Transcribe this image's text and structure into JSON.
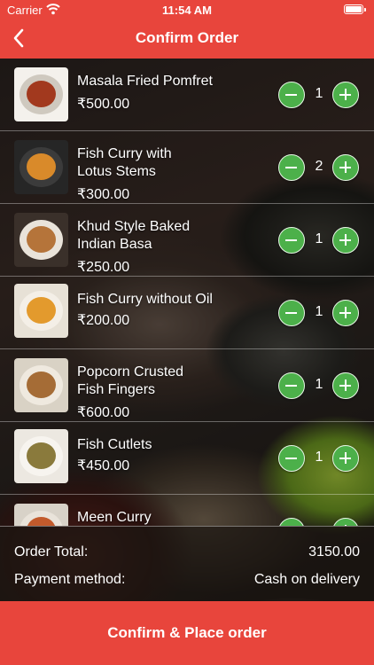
{
  "status_bar": {
    "carrier": "Carrier",
    "time": "11:54 AM"
  },
  "header": {
    "title": "Confirm Order",
    "back_icon": "chevron-left-icon"
  },
  "items": [
    {
      "name_line1": "Masala Fried Pomfret",
      "name_line2": "",
      "price": "₹500.00",
      "qty": "1"
    },
    {
      "name_line1": "Fish Curry with",
      "name_line2": "Lotus Stems",
      "price": "₹300.00",
      "qty": "2"
    },
    {
      "name_line1": "Khud Style Baked",
      "name_line2": "Indian Basa",
      "price": "₹250.00",
      "qty": "1"
    },
    {
      "name_line1": "Fish Curry without Oil",
      "name_line2": "",
      "price": "₹200.00",
      "qty": "1"
    },
    {
      "name_line1": "Popcorn Crusted",
      "name_line2": "Fish Fingers",
      "price": "₹600.00",
      "qty": "1"
    },
    {
      "name_line1": "Fish Cutlets",
      "name_line2": "",
      "price": "₹450.00",
      "qty": "1"
    },
    {
      "name_line1": "Meen Curry",
      "name_line2": "",
      "price": "",
      "qty": ""
    }
  ],
  "summary": {
    "total_label": "Order Total:",
    "total_value": "3150.00",
    "payment_label": "Payment method:",
    "payment_value": "Cash on delivery"
  },
  "actions": {
    "confirm_label": "Confirm & Place order"
  },
  "colors": {
    "brand_red": "#e8453c",
    "button_green": "#4cb04a"
  }
}
